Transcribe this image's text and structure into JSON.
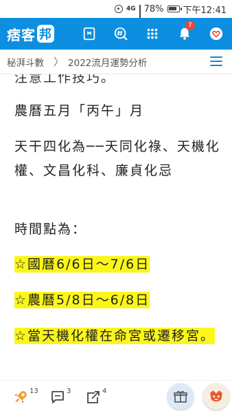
{
  "status_bar": {
    "network": "4G",
    "battery": "78%",
    "time": "下午12:41"
  },
  "header": {
    "logo_text": "痞客",
    "logo_mark": "邦",
    "notification_count": "7"
  },
  "breadcrumb": {
    "blog": "秘湃斗數",
    "separator": "〉",
    "article": "2022流月運勢分析"
  },
  "article": {
    "cut_text": "注意工作技巧。",
    "paragraphs": [
      "農曆五月「丙午」月",
      "天干四化為──天同化祿、天機化權、文昌化科、廉貞化忌",
      "時間點為：",
      "☆國曆6/6日～7/6日",
      "☆農曆5/8日～6/8日",
      "☆當天機化權在命宮或遷移宮。"
    ]
  },
  "bottom_bar": {
    "like_count": "13",
    "comment_count": "3",
    "share_count": "4"
  },
  "colors": {
    "brand_blue": "#0c8fe0",
    "highlight_yellow": "#fbf61a",
    "badge_red": "#e8483b"
  }
}
